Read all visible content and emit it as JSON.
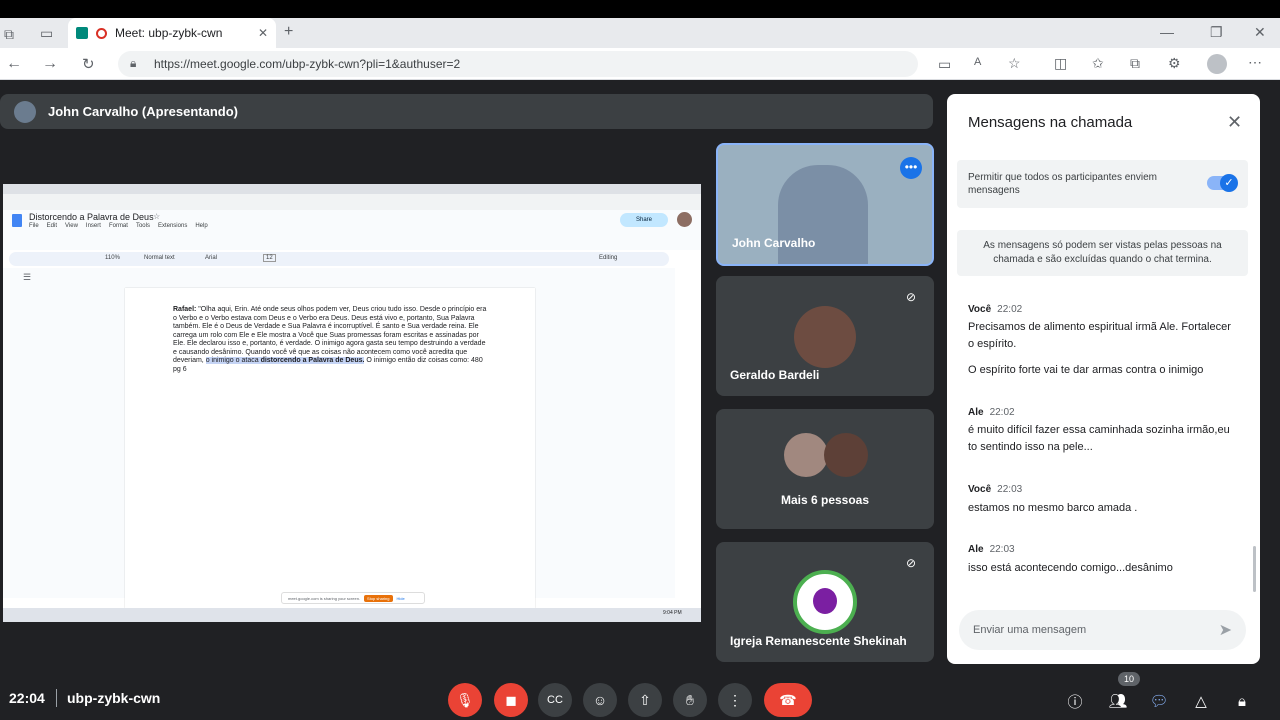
{
  "browser": {
    "tab_title": "Meet: ubp-zybk-cwn",
    "url": "https://meet.google.com/ubp-zybk-cwn?pli=1&authuser=2"
  },
  "presenter_bar": {
    "label": "John Carvalho (Apresentando)"
  },
  "shared_screen": {
    "doc_title": "Distorcendo a Palavra de Deus",
    "menus": [
      "File",
      "Edit",
      "View",
      "Insert",
      "Format",
      "Tools",
      "Extensions",
      "Help"
    ],
    "toolbar": {
      "zoom": "110%",
      "style": "Normal text",
      "font": "Arial",
      "size": "12",
      "mode": "Editing",
      "share": "Share"
    },
    "speaker": "Rafael:",
    "body_before": "\"Olha aqui, Erin. Até onde seus olhos podem ver, Deus criou tudo isso. Desde o princípio era o Verbo e o Verbo estava com Deus e o Verbo era Deus. Deus está vivo e, portanto, Sua Palavra também. Ele é o Deus de Verdade e Sua Palavra é incorruptível. É santo e Sua verdade reina. Ele carrega um rolo com Ele e Ele mostra a Você que Suas promessas foram escritas e assinadas por Ele. Ele declarou isso e, portanto, é verdade. O inimigo agora gasta seu tempo destruindo a verdade e causando desânimo. Quando você vê que as coisas não acontecem como você acredita que deveriam, ",
    "body_highlight": "o inimigo o ataca ",
    "body_highlight_bold": "distorcendo a Palavra de Deus.",
    "body_after": " O inimigo então diz coisas como: 480 pg 6",
    "sharing_bar": "meet.google.com is sharing your screen.",
    "stop_sharing": "Stop sharing",
    "hide": "Hide",
    "taskbar_time": "9:04 PM"
  },
  "tiles": [
    {
      "name": "John Carvalho"
    },
    {
      "name": "Geraldo Bardeli"
    },
    {
      "name": "Mais 6 pessoas"
    },
    {
      "name": "Igreja Remanescente Shekinah"
    }
  ],
  "chat": {
    "title": "Mensagens na chamada",
    "toggle_label": "Permitir que todos os participantes enviem mensagens",
    "notice": "As mensagens só podem ser vistas pelas pessoas na chamada e são excluídas quando o chat termina.",
    "messages": [
      {
        "sender": "Você",
        "time": "22:02",
        "lines": [
          "Precisamos de alimento espiritual irmã Ale. Fortalecer o espírito.",
          "O espírito forte vai te dar armas contra  o inimigo"
        ]
      },
      {
        "sender": "Ale",
        "time": "22:02",
        "lines": [
          "é muito difícil fazer essa caminhada sozinha irmão,eu to sentindo isso na pele..."
        ]
      },
      {
        "sender": "Você",
        "time": "22:03",
        "lines": [
          "estamos no mesmo barco amada ."
        ]
      },
      {
        "sender": "Ale",
        "time": "22:03",
        "lines": [
          "isso está acontecendo comigo...desânimo"
        ]
      }
    ],
    "input_placeholder": "Enviar uma mensagem"
  },
  "bottom": {
    "time": "22:04",
    "meeting_code": "ubp-zybk-cwn",
    "participants_count": "10"
  },
  "colors": {
    "accent": "#1a73e8",
    "danger": "#ea4335",
    "bg": "#202124",
    "tile": "#3c4043"
  }
}
